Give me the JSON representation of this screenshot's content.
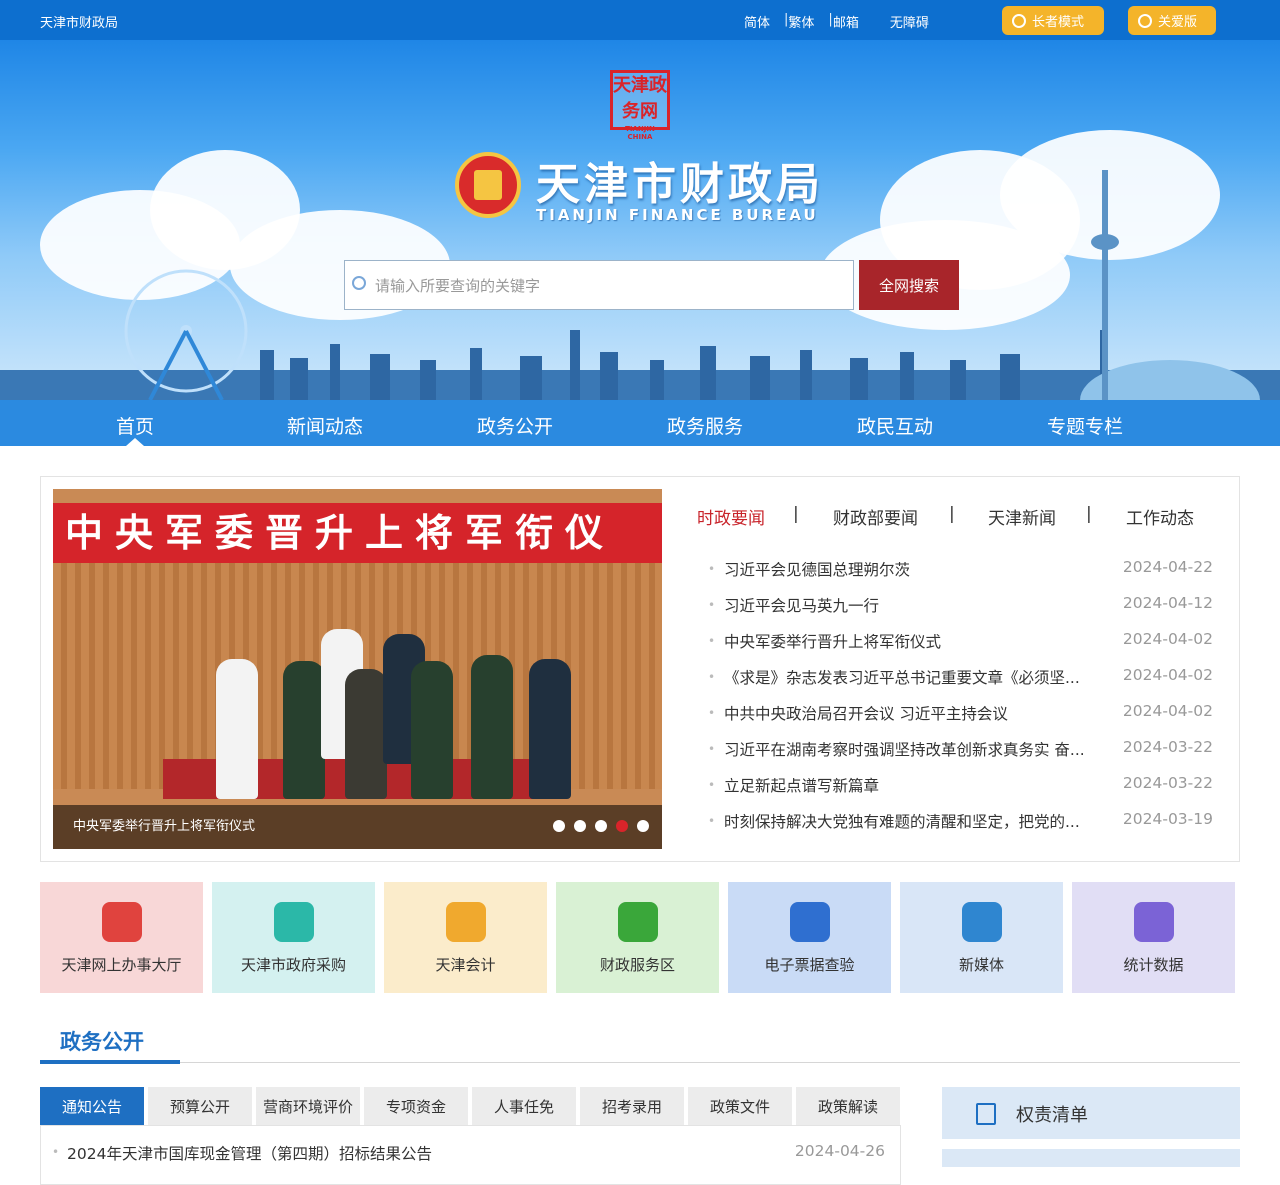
{
  "topbar": {
    "site_name": "天津市财政局",
    "links": [
      "简体",
      "繁体",
      "邮箱",
      "无障碍"
    ],
    "elder_mode": "长者模式",
    "care_version": "关爱版"
  },
  "header": {
    "seal_text": "天津政务网",
    "seal_sub": "TIANJIN CHINA",
    "title": "天津市财政局",
    "title_en": "TIANJIN FINANCE BUREAU"
  },
  "search": {
    "placeholder": "请输入所要查询的关键字",
    "button": "全网搜索"
  },
  "nav": {
    "items": [
      "首页",
      "新闻动态",
      "政务公开",
      "政务服务",
      "政民互动",
      "专题专栏"
    ]
  },
  "slider": {
    "banner_text": "中央军委晋升上将军衔仪式",
    "caption": "中央军委举行晋升上将军衔仪式",
    "active_index": 3,
    "count": 5
  },
  "news_tabs": [
    "时政要闻",
    "财政部要闻",
    "天津新闻",
    "工作动态"
  ],
  "news": [
    {
      "title": "习近平会见德国总理朔尔茨",
      "date": "2024-04-22"
    },
    {
      "title": "习近平会见马英九一行",
      "date": "2024-04-12"
    },
    {
      "title": "中央军委举行晋升上将军衔仪式",
      "date": "2024-04-02"
    },
    {
      "title": "《求是》杂志发表习近平总书记重要文章《必须坚...",
      "date": "2024-04-02"
    },
    {
      "title": "中共中央政治局召开会议 习近平主持会议",
      "date": "2024-04-02"
    },
    {
      "title": "习近平在湖南考察时强调坚持改革创新求真务实 奋...",
      "date": "2024-03-22"
    },
    {
      "title": "立足新起点谱写新篇章",
      "date": "2024-03-22"
    },
    {
      "title": "时刻保持解决大党独有难题的清醒和坚定，把党的...",
      "date": "2024-03-19"
    }
  ],
  "tiles": [
    {
      "label": "天津网上办事大厅",
      "icon": "globe-icon",
      "bg": "#f8d7d7",
      "color": "#e0433e"
    },
    {
      "label": "天津市政府采购",
      "icon": "layers-icon",
      "bg": "#d4f1f0",
      "color": "#2bb8a8"
    },
    {
      "label": "天津会计",
      "icon": "user-icon",
      "bg": "#fbeccb",
      "color": "#f0a92e"
    },
    {
      "label": "财政服务区",
      "icon": "monitor-icon",
      "bg": "#d9f1d4",
      "color": "#3aa73a"
    },
    {
      "label": "电子票据查验",
      "icon": "receipt-icon",
      "bg": "#c9dbf6",
      "color": "#2f6fd0"
    },
    {
      "label": "新媒体",
      "icon": "news-icon",
      "bg": "#d9e6f7",
      "color": "#2f86d0"
    },
    {
      "label": "统计数据",
      "icon": "bar-chart-icon",
      "bg": "#e1def5",
      "color": "#7b63d6"
    }
  ],
  "section": {
    "title": "政务公开",
    "tabs": [
      "通知公告",
      "预算公开",
      "营商环境评价",
      "专项资金",
      "人事任免",
      "招考录用",
      "政策文件",
      "政策解读"
    ],
    "items": [
      {
        "title": "2024年天津市国库现金管理（第四期）招标结果公告",
        "date": "2024-04-26"
      }
    ],
    "side": [
      "权责清单"
    ]
  },
  "colors": {
    "topbar": "#0d6fcf",
    "nav": "#2b8ae0",
    "accent_red": "#a8252a",
    "pill": "#f4b42a",
    "active_tab": "#c8232a"
  }
}
